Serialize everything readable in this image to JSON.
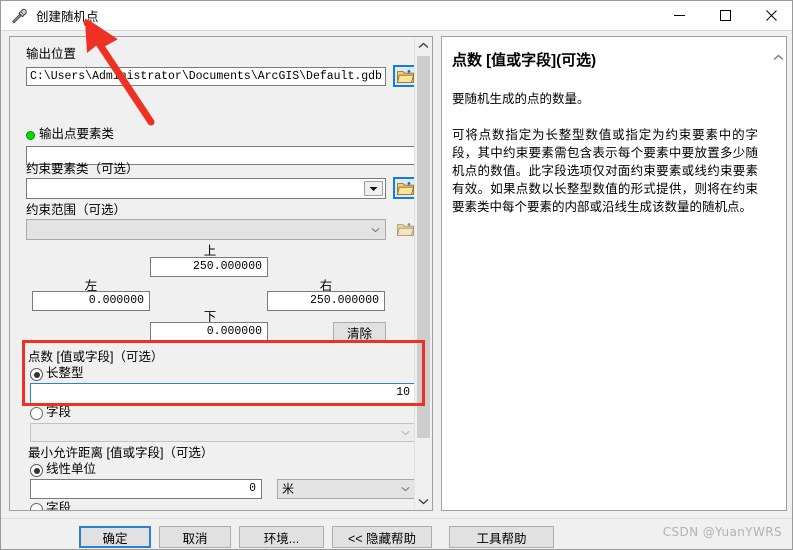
{
  "window": {
    "title": "创建随机点",
    "icon": "hammer-tool-icon",
    "minimize": "—",
    "maximize": "□",
    "close": "✕"
  },
  "params": {
    "output_location": {
      "label": "输出位置",
      "value": "C:\\Users\\Administrator\\Documents\\ArcGIS\\Default.gdb"
    },
    "output_point_fc": {
      "label": "输出点要素类",
      "value": "",
      "required": true
    },
    "constraining_fc": {
      "label": "约束要素类（可选）",
      "value": ""
    },
    "constraining_extent": {
      "label": "约束范围（可选）",
      "value": ""
    },
    "extent": {
      "top_label": "上",
      "top_value": "250.000000",
      "left_label": "左",
      "left_value": "0.000000",
      "right_label": "右",
      "right_value": "250.000000",
      "bottom_label": "下",
      "bottom_value": "0.000000",
      "clear_label": "清除"
    },
    "point_count": {
      "label": "点数 [值或字段]（可选）",
      "radio_long_label": "长整型",
      "radio_long_selected": true,
      "long_value": "10",
      "radio_field_label": "字段",
      "radio_field_selected": false,
      "field_value": ""
    },
    "min_distance": {
      "label": "最小允许距离 [值或字段]（可选）",
      "radio_linear_label": "线性单位",
      "radio_linear_selected": true,
      "linear_value": "0",
      "linear_unit": "米",
      "radio_field_label": "字段",
      "radio_field_selected": false,
      "field_value": ""
    }
  },
  "help": {
    "title_main": "点数 ",
    "title_bracket": "[值或字段]",
    "title_optional": "(可选)",
    "paragraph1": "要随机生成的点的数量。",
    "paragraph2": "可将点数指定为长整型数值或指定为约束要素中的字段，其中约束要素需包含表示每个要素中要放置多少随机点的数值。此字段选项仅对面约束要素或线约束要素有效。如果点数以长整型数值的形式提供，则将在约束要素类中每个要素的内部或沿线生成该数量的随机点。"
  },
  "buttons": {
    "ok": "确定",
    "cancel": "取消",
    "environments": "环境...",
    "hide_help": "<< 隐藏帮助",
    "tool_help": "工具帮助"
  },
  "watermark": "CSDN @YuanYWRS",
  "colors": {
    "annotation_red": "#ef3124",
    "focus_blue": "#2b7fd4",
    "required_green": "#00e000"
  }
}
